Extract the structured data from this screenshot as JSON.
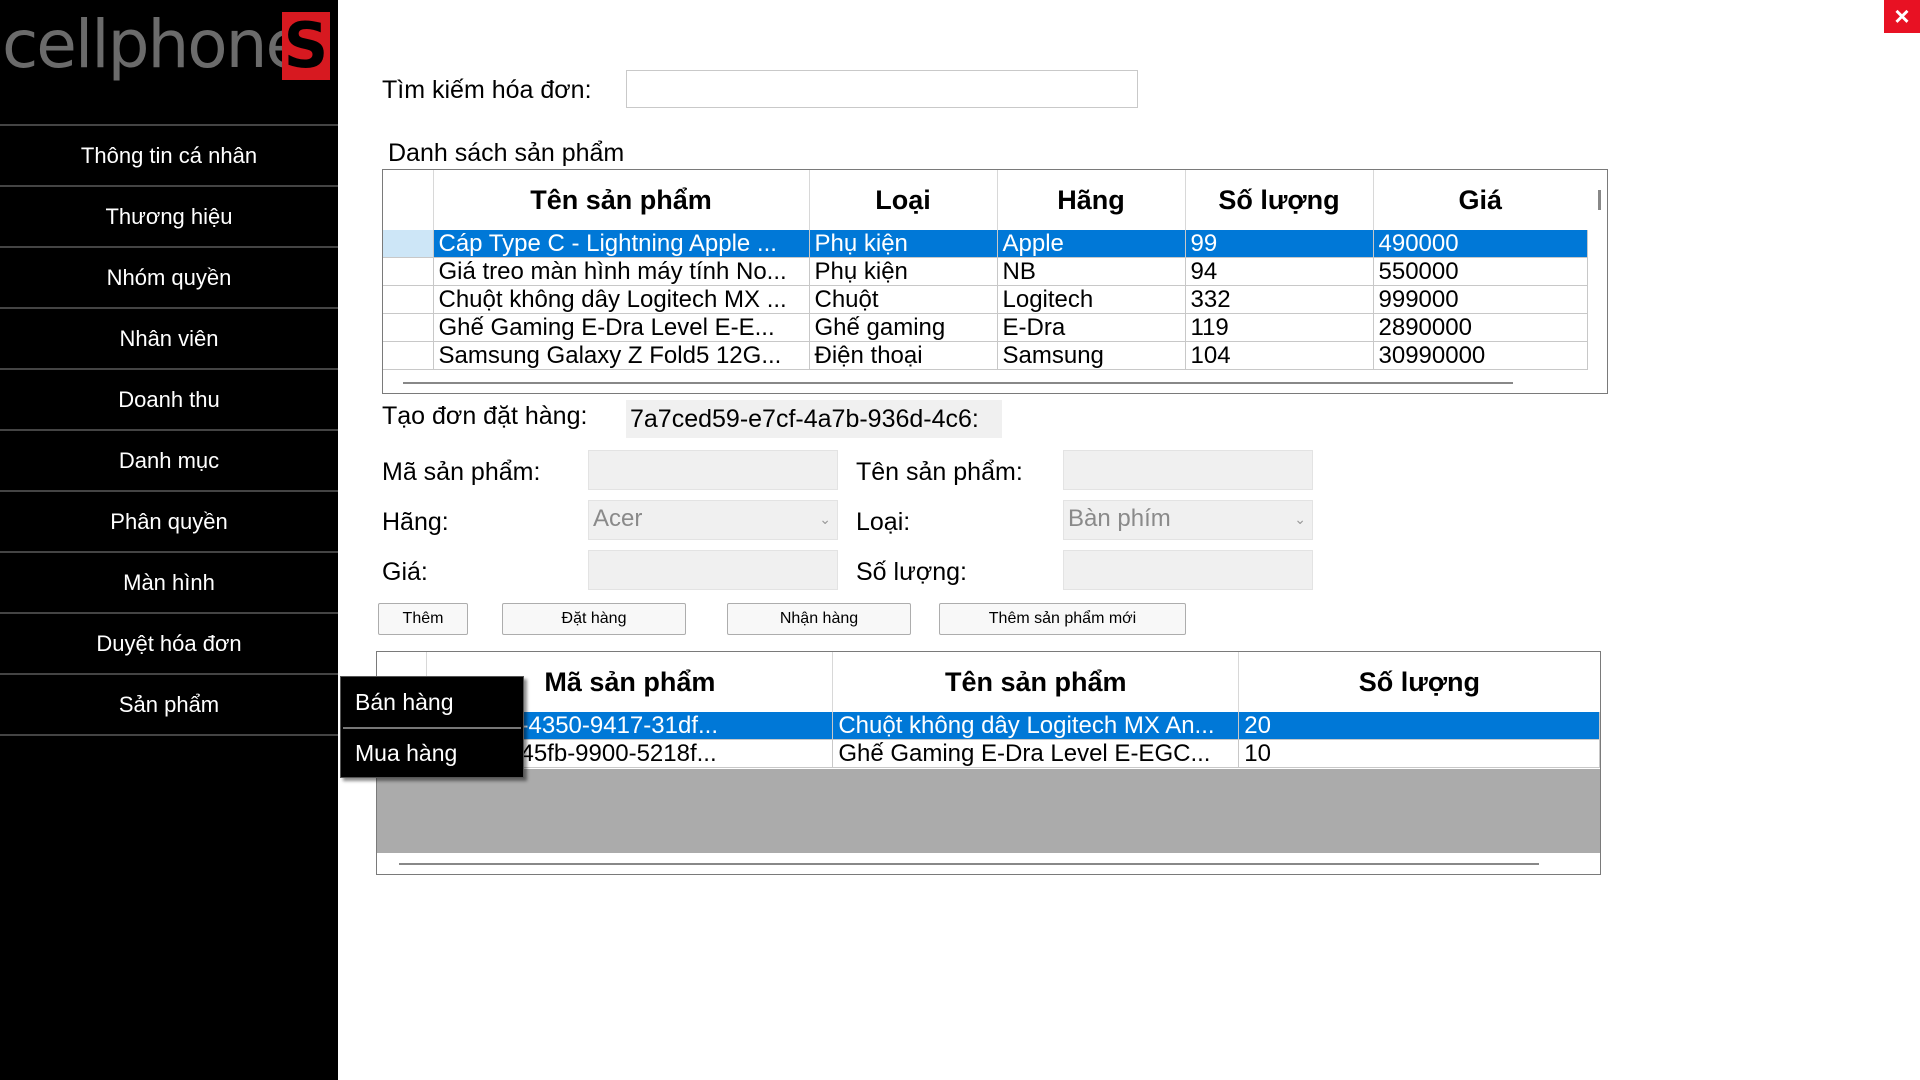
{
  "app": {
    "logo_text": "cellphone",
    "logo_mark": "S",
    "close_icon": "×"
  },
  "sidebar": {
    "items": [
      {
        "label": "Thông tin cá nhân"
      },
      {
        "label": "Thương hiệu"
      },
      {
        "label": "Nhóm quyền"
      },
      {
        "label": "Nhân viên"
      },
      {
        "label": "Doanh thu"
      },
      {
        "label": "Danh mục"
      },
      {
        "label": "Phân quyền"
      },
      {
        "label": "Màn hình"
      },
      {
        "label": "Duyệt hóa đơn"
      },
      {
        "label": "Sản phẩm"
      }
    ],
    "submenu": [
      {
        "label": "Bán hàng"
      },
      {
        "label": "Mua hàng"
      }
    ]
  },
  "search": {
    "label": "Tìm kiếm hóa đơn:",
    "value": ""
  },
  "product_list": {
    "title": "Danh sách sản phẩm",
    "columns": [
      "Tên sản phẩm",
      "Loại",
      "Hãng",
      "Số lượng",
      "Giá"
    ],
    "rows": [
      [
        "Cáp Type C - Lightning Apple ...",
        "Phụ kiện",
        "Apple",
        "99",
        "490000"
      ],
      [
        "Giá treo màn hình máy tính No...",
        "Phụ kiện",
        "NB",
        "94",
        "550000"
      ],
      [
        "Chuột không dây Logitech MX ...",
        "Chuột",
        "Logitech",
        "332",
        "999000"
      ],
      [
        "Ghế Gaming E-Dra Level E-E...",
        "Ghế gaming",
        "E-Dra",
        "119",
        "2890000"
      ],
      [
        "Samsung Galaxy Z Fold5 12G...",
        "Điện thoại",
        "Samsung",
        "104",
        "30990000"
      ]
    ]
  },
  "order": {
    "label": "Tạo đơn đặt hàng:",
    "id": "7a7ced59-e7cf-4a7b-936d-4c6:"
  },
  "form": {
    "product_id_label": "Mã sản phẩm:",
    "product_name_label": "Tên sản phẩm:",
    "brand_label": "Hãng:",
    "brand_value": "Acer",
    "type_label": "Loại:",
    "type_value": "Bàn phím",
    "price_label": "Giá:",
    "quantity_label": "Số lượng:"
  },
  "buttons": {
    "add": "Thêm",
    "order": "Đặt hàng",
    "receive": "Nhận hàng",
    "add_new_product": "Thêm sản phẩm mới"
  },
  "order_items": {
    "columns": [
      "Mã sản phẩm",
      "Tên sản phẩm",
      "Số lượng"
    ],
    "rows": [
      [
        "74-26d4-4350-9417-31df...",
        "Chuột không dây Logitech MX An...",
        "20"
      ],
      [
        "de-67fc-45fb-9900-5218f...",
        "Ghế Gaming E-Dra Level E-EGC...",
        "10"
      ]
    ]
  }
}
